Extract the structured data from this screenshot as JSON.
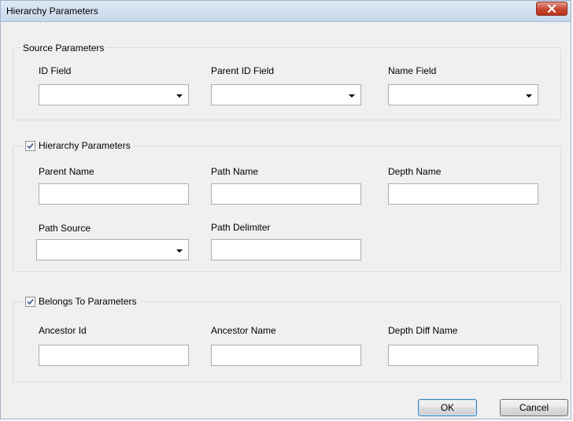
{
  "window": {
    "title": "Hierarchy Parameters"
  },
  "source_group": {
    "legend": "Source Parameters",
    "id_field_label": "ID Field",
    "parent_id_field_label": "Parent ID Field",
    "name_field_label": "Name Field",
    "id_field_value": "",
    "parent_id_field_value": "",
    "name_field_value": ""
  },
  "hierarchy_group": {
    "legend": "Hierarchy Parameters",
    "checked": true,
    "parent_name_label": "Parent Name",
    "path_name_label": "Path Name",
    "depth_name_label": "Depth Name",
    "path_source_label": "Path Source",
    "path_delimiter_label": "Path Delimiter",
    "parent_name_value": "",
    "path_name_value": "",
    "depth_name_value": "",
    "path_source_value": "",
    "path_delimiter_value": ""
  },
  "belongs_group": {
    "legend": "Belongs To Parameters",
    "checked": true,
    "ancestor_id_label": "Ancestor Id",
    "ancestor_name_label": "Ancestor Name",
    "depth_diff_name_label": "Depth Diff Name",
    "ancestor_id_value": "",
    "ancestor_name_value": "",
    "depth_diff_name_value": ""
  },
  "buttons": {
    "ok": "OK",
    "cancel": "Cancel"
  },
  "icons": {
    "close": "close-icon",
    "check": "checkmark-icon",
    "dropdown": "chevron-down-icon"
  }
}
